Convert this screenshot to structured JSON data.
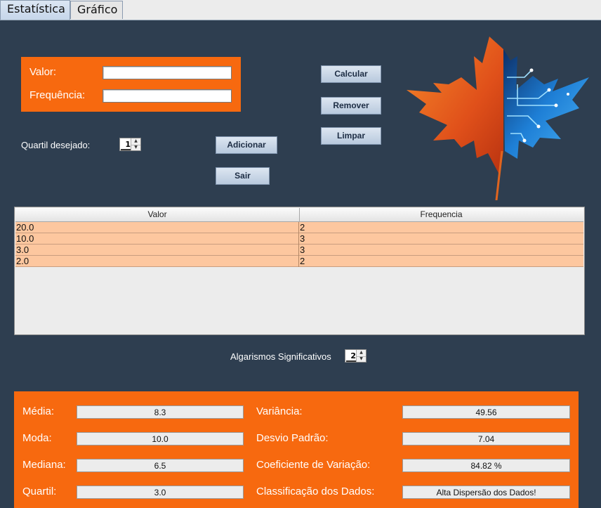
{
  "tabs": [
    {
      "label": "Estatística",
      "active": true
    },
    {
      "label": "Gráfico",
      "active": false
    }
  ],
  "inputs": {
    "valor_label": "Valor:",
    "valor_value": "",
    "frequencia_label": "Frequência:",
    "frequencia_value": ""
  },
  "quartil": {
    "label": "Quartil desejado:",
    "value": "1"
  },
  "buttons": {
    "calcular": "Calcular",
    "remover": "Remover",
    "limpar": "Limpar",
    "adicionar": "Adicionar",
    "sair": "Sair"
  },
  "table": {
    "headers": [
      "Valor",
      "Frequencia"
    ],
    "rows": [
      [
        "20.0",
        "2"
      ],
      [
        "10.0",
        "3"
      ],
      [
        "3.0",
        "3"
      ],
      [
        "2.0",
        "2"
      ]
    ]
  },
  "significativos": {
    "label": "Algarismos Significativos",
    "value": "2"
  },
  "results": {
    "media_label": "Média:",
    "media_value": "8.3",
    "moda_label": "Moda:",
    "moda_value": "10.0",
    "mediana_label": "Mediana:",
    "mediana_value": "6.5",
    "quartil_label": "Quartil:",
    "quartil_value": "3.0",
    "variancia_label": "Variância:",
    "variancia_value": "49.56",
    "desvio_label": "Desvio Padrão:",
    "desvio_value": "7.04",
    "coef_label": "Coeficiente de Variação:",
    "coef_value": "84.82 %",
    "class_label": "Classificação dos Dados:",
    "class_value": "Alta Dispersão dos Dados!"
  },
  "colors": {
    "panel_bg": "#2e3e50",
    "orange": "#f7690f",
    "row_highlight": "#fdc79f",
    "circuit_blue": "#1e7fd6"
  },
  "icons": {
    "logo": "maple-leaf-circuit-logo"
  }
}
